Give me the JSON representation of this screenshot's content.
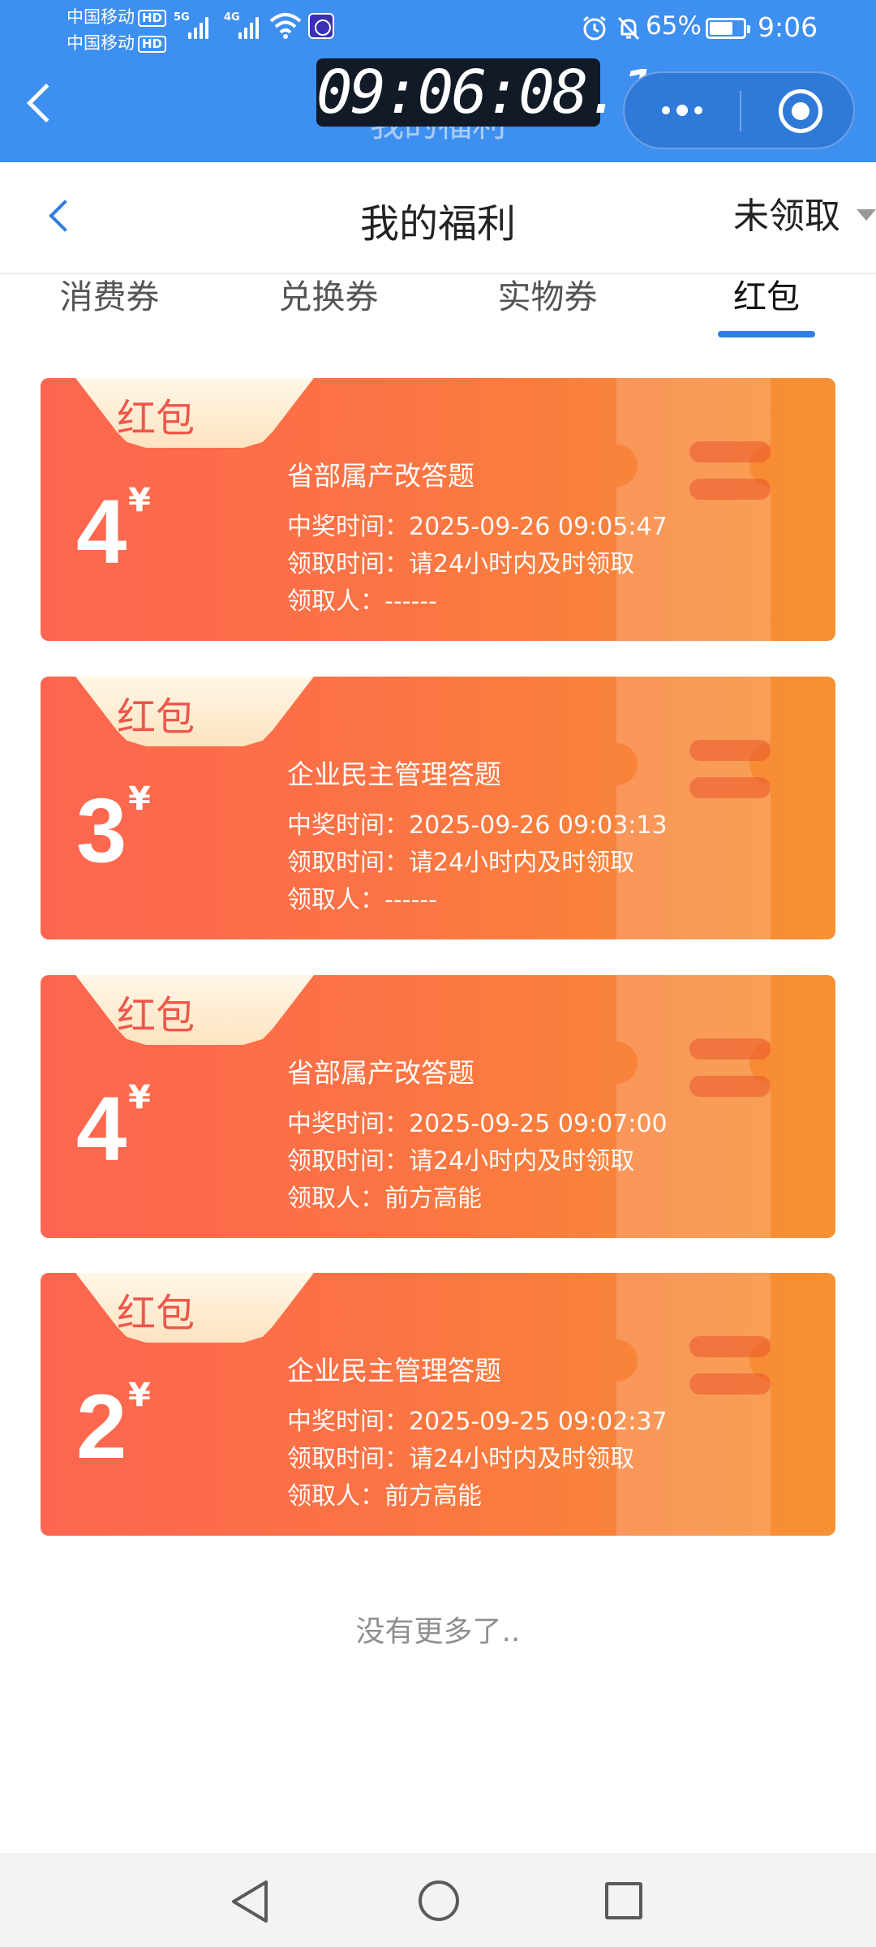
{
  "status_bar": {
    "carrier1": "中国移动",
    "carrier2": "中国移动",
    "hd_label": "HD",
    "net1": "5G",
    "net2": "4G",
    "battery": "65%",
    "time": "9:06",
    "icons": [
      "signal-icon",
      "wifi-icon",
      "app-status-icon",
      "alarm-icon",
      "mute-icon",
      "battery-icon"
    ]
  },
  "mini_app_bar": {
    "timer": "09:06:08.1",
    "ghost_title": "我的福利",
    "icons": [
      "back-icon",
      "more-dots-icon",
      "target-icon"
    ]
  },
  "header": {
    "title": "我的福利",
    "filter": "未领取"
  },
  "tabs": [
    {
      "label": "消费券"
    },
    {
      "label": "兑换券"
    },
    {
      "label": "实物券"
    },
    {
      "label": "红包"
    }
  ],
  "active_tab": "红包",
  "coupons": [
    {
      "badge": "红包",
      "amount": "4",
      "currency": "¥",
      "name": "省部属产改答题",
      "win_time": "中奖时间：2025-09-26 09:05:47",
      "claim_time": "领取时间：请24小时内及时领取",
      "claimer": "领取人：------"
    },
    {
      "badge": "红包",
      "amount": "3",
      "currency": "¥",
      "name": "企业民主管理答题",
      "win_time": "中奖时间：2025-09-26 09:03:13",
      "claim_time": "领取时间：请24小时内及时领取",
      "claimer": "领取人：------"
    },
    {
      "badge": "红包",
      "amount": "4",
      "currency": "¥",
      "name": "省部属产改答题",
      "win_time": "中奖时间：2025-09-25 09:07:00",
      "claim_time": "领取时间：请24小时内及时领取",
      "claimer": "领取人：前方高能"
    },
    {
      "badge": "红包",
      "amount": "2",
      "currency": "¥",
      "name": "企业民主管理答题",
      "win_time": "中奖时间：2025-09-25 09:02:37",
      "claim_time": "领取时间：请24小时内及时领取",
      "claimer": "领取人：前方高能"
    }
  ],
  "footer": {
    "no_more": "没有更多了.."
  },
  "colors": {
    "top_bar": "#3d8ff0",
    "accent": "#2f7de1",
    "card_start": "#fd6550",
    "card_end": "#f69132",
    "badge_text": "#f0564a"
  },
  "nav_bar_icons": [
    "nav-back-icon",
    "nav-home-icon",
    "nav-recent-icon"
  ]
}
